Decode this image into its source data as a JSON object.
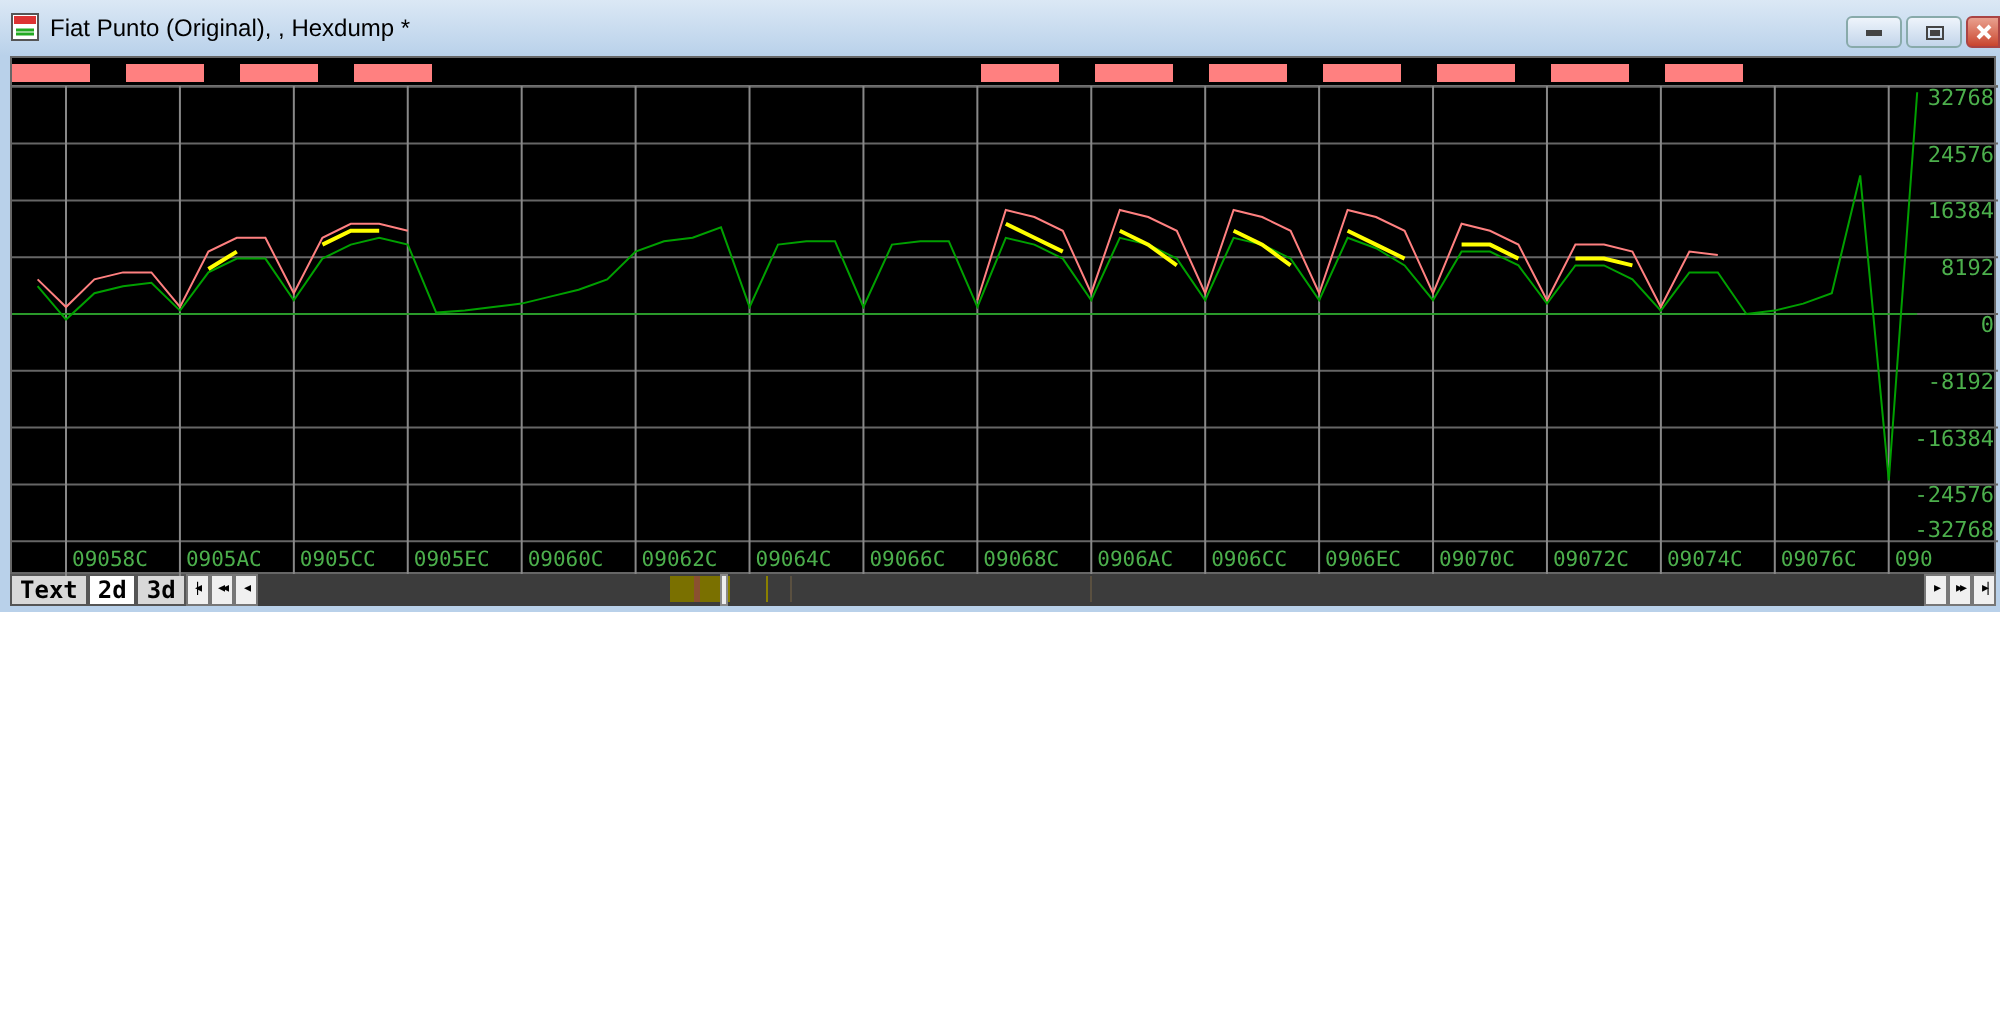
{
  "window": {
    "title": "Fiat Punto (Original), , Hexdump *"
  },
  "graph": {
    "y_labels": [
      "32768",
      "24576",
      "16384",
      "8192",
      "0",
      "-8192",
      "-16384",
      "-24576",
      "-32768"
    ],
    "x_labels": [
      "09058C",
      "0905AC",
      "0905CC",
      "0905EC",
      "09060C",
      "09062C",
      "09064C",
      "09066C",
      "09068C",
      "0906AC",
      "0906CC",
      "0906EC",
      "09070C",
      "09072C",
      "09074C",
      "09076C",
      "090"
    ]
  },
  "view_tabs": [
    {
      "label": "Text",
      "selected": false
    },
    {
      "label": "2d",
      "selected": true
    },
    {
      "label": "3d",
      "selected": false
    }
  ],
  "nav_left": [
    "|◂",
    "◂◂",
    "◂"
  ],
  "nav_right": [
    "▸",
    "▸▸",
    "▸|"
  ]
}
